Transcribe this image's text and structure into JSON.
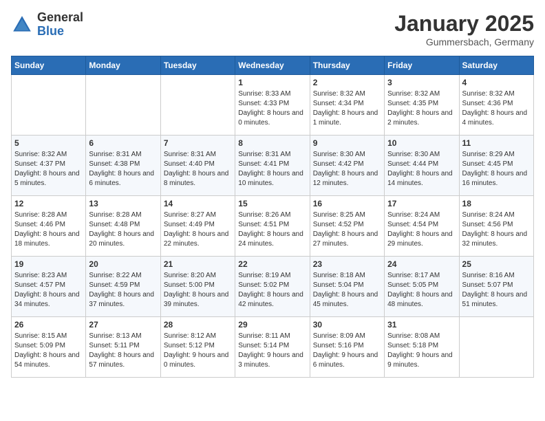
{
  "header": {
    "logo_general": "General",
    "logo_blue": "Blue",
    "month_title": "January 2025",
    "location": "Gummersbach, Germany"
  },
  "days_of_week": [
    "Sunday",
    "Monday",
    "Tuesday",
    "Wednesday",
    "Thursday",
    "Friday",
    "Saturday"
  ],
  "weeks": [
    [
      {
        "day": "",
        "info": ""
      },
      {
        "day": "",
        "info": ""
      },
      {
        "day": "",
        "info": ""
      },
      {
        "day": "1",
        "info": "Sunrise: 8:33 AM\nSunset: 4:33 PM\nDaylight: 8 hours\nand 0 minutes."
      },
      {
        "day": "2",
        "info": "Sunrise: 8:32 AM\nSunset: 4:34 PM\nDaylight: 8 hours\nand 1 minute."
      },
      {
        "day": "3",
        "info": "Sunrise: 8:32 AM\nSunset: 4:35 PM\nDaylight: 8 hours\nand 2 minutes."
      },
      {
        "day": "4",
        "info": "Sunrise: 8:32 AM\nSunset: 4:36 PM\nDaylight: 8 hours\nand 4 minutes."
      }
    ],
    [
      {
        "day": "5",
        "info": "Sunrise: 8:32 AM\nSunset: 4:37 PM\nDaylight: 8 hours\nand 5 minutes."
      },
      {
        "day": "6",
        "info": "Sunrise: 8:31 AM\nSunset: 4:38 PM\nDaylight: 8 hours\nand 6 minutes."
      },
      {
        "day": "7",
        "info": "Sunrise: 8:31 AM\nSunset: 4:40 PM\nDaylight: 8 hours\nand 8 minutes."
      },
      {
        "day": "8",
        "info": "Sunrise: 8:31 AM\nSunset: 4:41 PM\nDaylight: 8 hours\nand 10 minutes."
      },
      {
        "day": "9",
        "info": "Sunrise: 8:30 AM\nSunset: 4:42 PM\nDaylight: 8 hours\nand 12 minutes."
      },
      {
        "day": "10",
        "info": "Sunrise: 8:30 AM\nSunset: 4:44 PM\nDaylight: 8 hours\nand 14 minutes."
      },
      {
        "day": "11",
        "info": "Sunrise: 8:29 AM\nSunset: 4:45 PM\nDaylight: 8 hours\nand 16 minutes."
      }
    ],
    [
      {
        "day": "12",
        "info": "Sunrise: 8:28 AM\nSunset: 4:46 PM\nDaylight: 8 hours\nand 18 minutes."
      },
      {
        "day": "13",
        "info": "Sunrise: 8:28 AM\nSunset: 4:48 PM\nDaylight: 8 hours\nand 20 minutes."
      },
      {
        "day": "14",
        "info": "Sunrise: 8:27 AM\nSunset: 4:49 PM\nDaylight: 8 hours\nand 22 minutes."
      },
      {
        "day": "15",
        "info": "Sunrise: 8:26 AM\nSunset: 4:51 PM\nDaylight: 8 hours\nand 24 minutes."
      },
      {
        "day": "16",
        "info": "Sunrise: 8:25 AM\nSunset: 4:52 PM\nDaylight: 8 hours\nand 27 minutes."
      },
      {
        "day": "17",
        "info": "Sunrise: 8:24 AM\nSunset: 4:54 PM\nDaylight: 8 hours\nand 29 minutes."
      },
      {
        "day": "18",
        "info": "Sunrise: 8:24 AM\nSunset: 4:56 PM\nDaylight: 8 hours\nand 32 minutes."
      }
    ],
    [
      {
        "day": "19",
        "info": "Sunrise: 8:23 AM\nSunset: 4:57 PM\nDaylight: 8 hours\nand 34 minutes."
      },
      {
        "day": "20",
        "info": "Sunrise: 8:22 AM\nSunset: 4:59 PM\nDaylight: 8 hours\nand 37 minutes."
      },
      {
        "day": "21",
        "info": "Sunrise: 8:20 AM\nSunset: 5:00 PM\nDaylight: 8 hours\nand 39 minutes."
      },
      {
        "day": "22",
        "info": "Sunrise: 8:19 AM\nSunset: 5:02 PM\nDaylight: 8 hours\nand 42 minutes."
      },
      {
        "day": "23",
        "info": "Sunrise: 8:18 AM\nSunset: 5:04 PM\nDaylight: 8 hours\nand 45 minutes."
      },
      {
        "day": "24",
        "info": "Sunrise: 8:17 AM\nSunset: 5:05 PM\nDaylight: 8 hours\nand 48 minutes."
      },
      {
        "day": "25",
        "info": "Sunrise: 8:16 AM\nSunset: 5:07 PM\nDaylight: 8 hours\nand 51 minutes."
      }
    ],
    [
      {
        "day": "26",
        "info": "Sunrise: 8:15 AM\nSunset: 5:09 PM\nDaylight: 8 hours\nand 54 minutes."
      },
      {
        "day": "27",
        "info": "Sunrise: 8:13 AM\nSunset: 5:11 PM\nDaylight: 8 hours\nand 57 minutes."
      },
      {
        "day": "28",
        "info": "Sunrise: 8:12 AM\nSunset: 5:12 PM\nDaylight: 9 hours\nand 0 minutes."
      },
      {
        "day": "29",
        "info": "Sunrise: 8:11 AM\nSunset: 5:14 PM\nDaylight: 9 hours\nand 3 minutes."
      },
      {
        "day": "30",
        "info": "Sunrise: 8:09 AM\nSunset: 5:16 PM\nDaylight: 9 hours\nand 6 minutes."
      },
      {
        "day": "31",
        "info": "Sunrise: 8:08 AM\nSunset: 5:18 PM\nDaylight: 9 hours\nand 9 minutes."
      },
      {
        "day": "",
        "info": ""
      }
    ]
  ]
}
